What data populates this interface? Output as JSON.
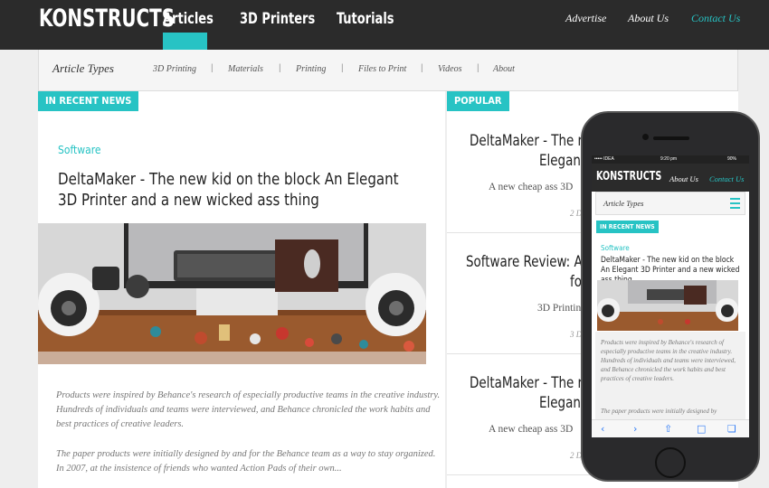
{
  "header": {
    "logo": "KONSTRUCTS",
    "nav": [
      "Articles",
      "3D Printers",
      "Tutorials"
    ],
    "active_nav": "Articles",
    "right_links": [
      "Advertise",
      "About Us",
      "Contact Us"
    ]
  },
  "article_types": {
    "title": "Article Types",
    "links": [
      "3D Printing",
      "Materials",
      "Printing",
      "Files to Print",
      "Videos",
      "About"
    ],
    "separator": "|"
  },
  "recent": {
    "tag": "IN RECENT NEWS",
    "category": "Software",
    "headline": "DeltaMaker - The new kid on the block An Elegant 3D Printer and a new wicked ass thing",
    "excerpt1": "Products were inspired by Behance's research of especially productive teams in the creative industry. Hundreds of individuals and teams were interviewed, and Behance chronicled the work habits and best practices of creative leaders.",
    "excerpt2": "The paper products were initially designed by and for the Behance team as a way to stay organized. In 2007, at the insistence of friends who wanted Action Pads of their own..."
  },
  "popular": {
    "tag": "POPULAR",
    "items": [
      {
        "title1": "DeltaMaker - The n",
        "title2": "Elegant",
        "sub": "A new cheap ass 3D",
        "meta": "2 D"
      },
      {
        "title1": "Software Review: Au",
        "title2": "fo",
        "sub": "3D Printin",
        "meta": "3 D"
      },
      {
        "title1": "DeltaMaker - The n",
        "title2": "Elegant",
        "sub": "A new cheap ass 3D",
        "meta": "2 D"
      }
    ]
  },
  "phone": {
    "status_left": "••••• IDEA",
    "status_time": "9:20 pm",
    "status_right": "90%",
    "logo": "KONSTRUCTS",
    "links": [
      "About Us",
      "Contact Us"
    ],
    "types_title": "Article Types",
    "tag": "IN RECENT NEWS",
    "category": "Software",
    "headline": "DeltaMaker - The new kid on the block An Elegant 3D Printer and a new wicked ass thing",
    "excerpt1": "Products were inspired by Behance's research of especially productive teams in the creative industry. Hundreds of individuals and teams were interviewed, and Behance chronicled the work habits and best practices of creative leaders.",
    "excerpt2": "The paper products were initially designed by",
    "toolbar_icons": [
      "back-arrow-icon",
      "forward-arrow-icon",
      "share-icon",
      "bookmarks-icon",
      "tabs-icon"
    ]
  },
  "colors": {
    "accent": "#27c3c4",
    "header_bg": "#2b2b2b",
    "page_bg": "#eeeeee"
  }
}
